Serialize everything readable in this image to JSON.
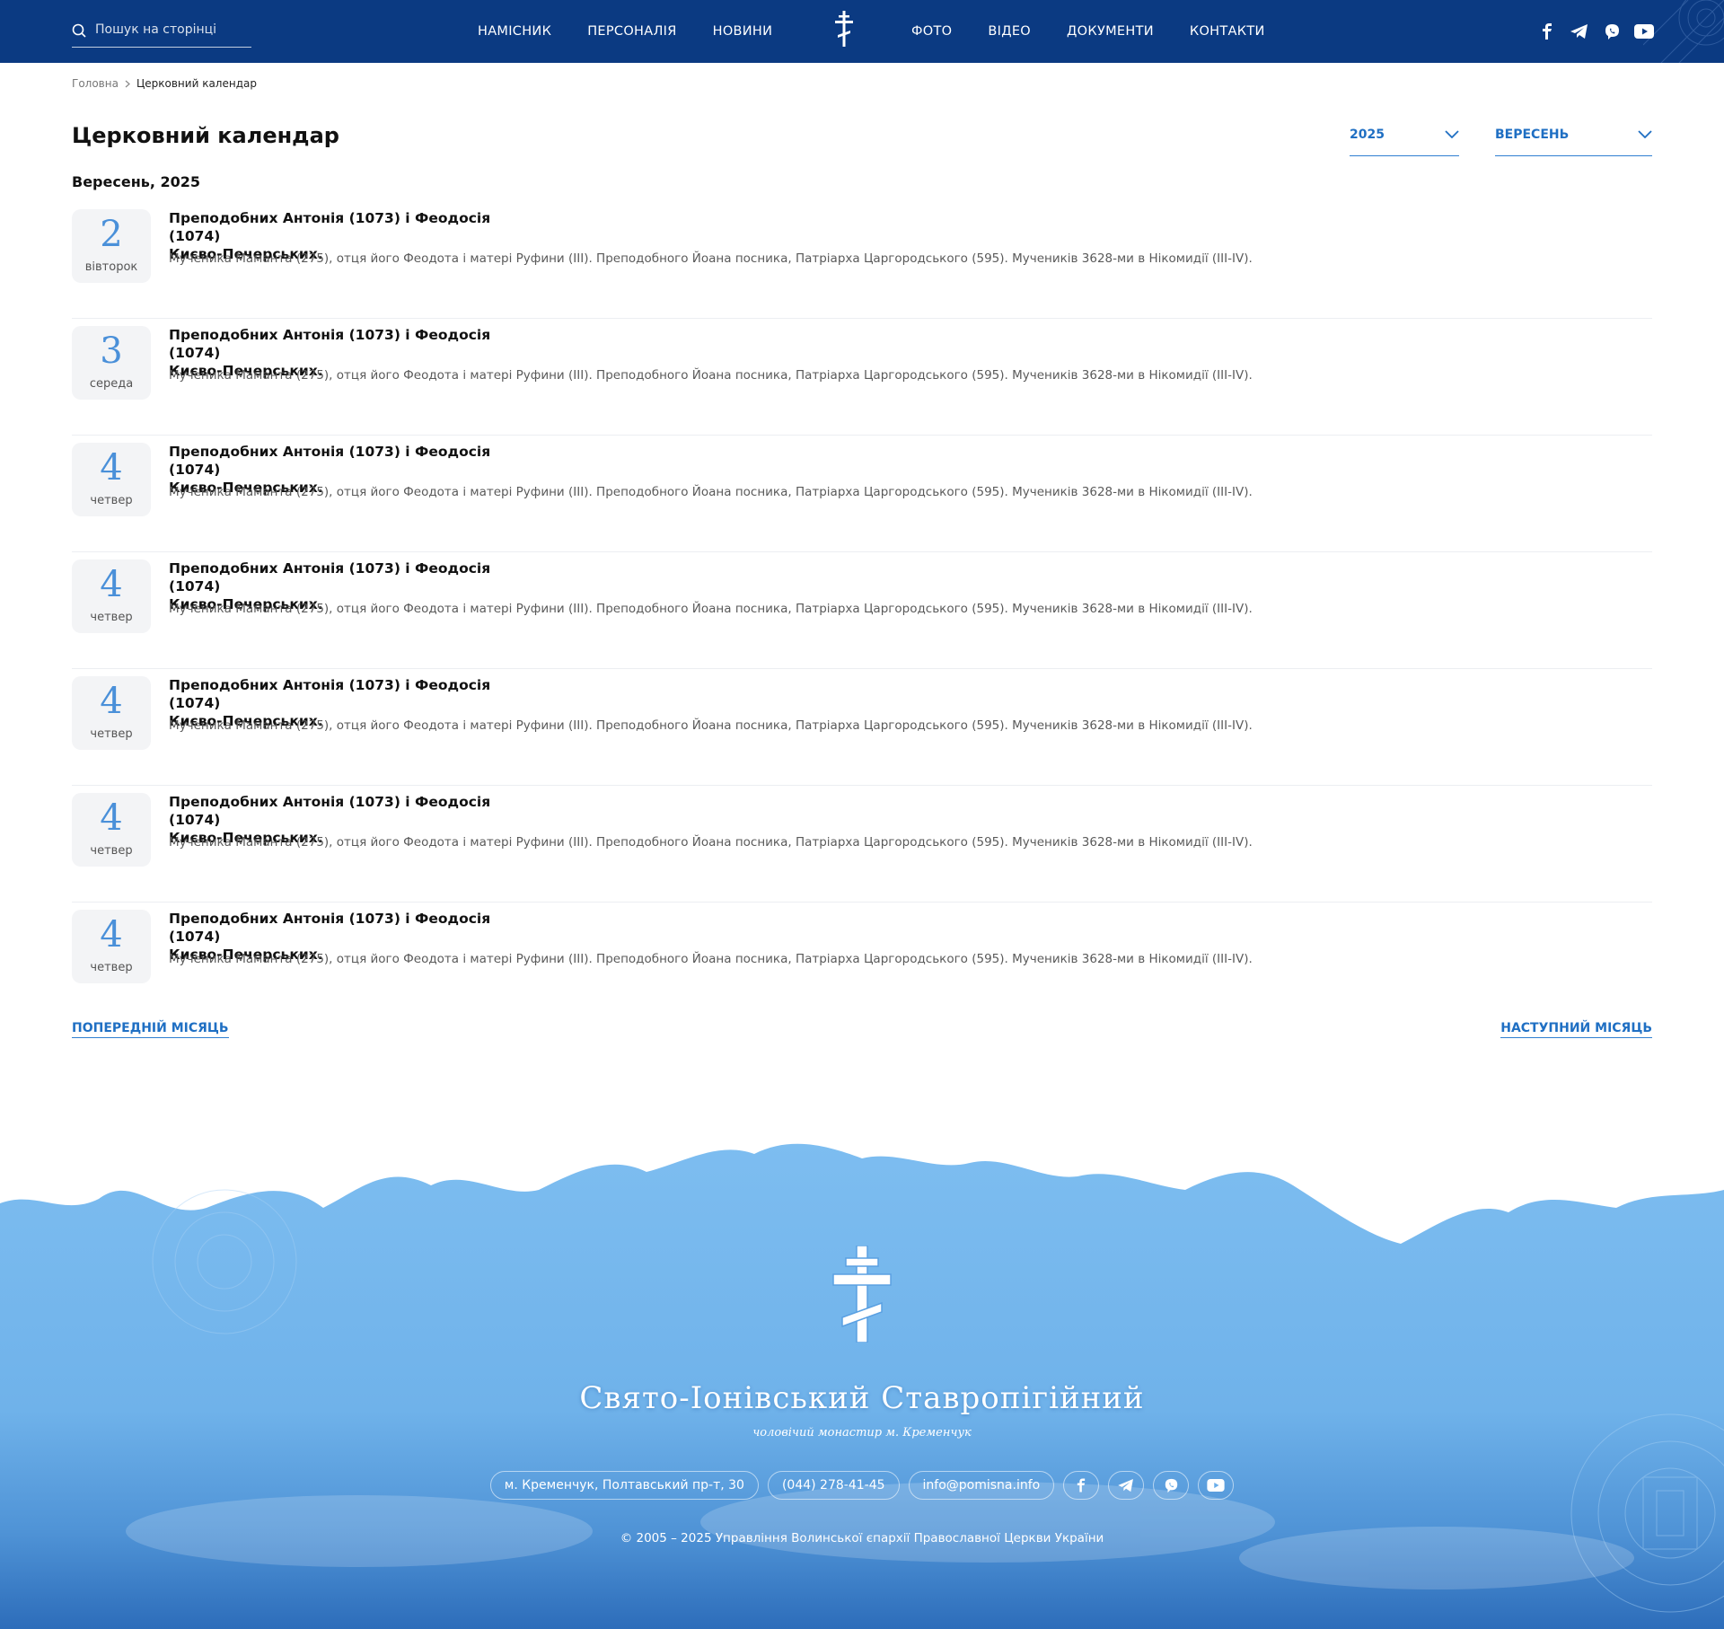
{
  "header": {
    "search_placeholder": "Пошук на сторінці",
    "nav_left": [
      "НАМІСНИК",
      "ПЕРСОНАЛІЯ",
      "НОВИНИ"
    ],
    "nav_right": [
      "ФОТО",
      "ВІДЕО",
      "ДОКУМЕНТИ",
      "КОНТАКТИ"
    ],
    "socials": [
      "facebook-icon",
      "telegram-icon",
      "viber-icon",
      "youtube-icon"
    ]
  },
  "breadcrumb": {
    "home": "Головна",
    "current": "Церковний календар"
  },
  "page": {
    "title": "Церковний календар",
    "year_select": "2025",
    "month_select": "ВЕРЕСЕНЬ",
    "month_heading": "Вересень, 2025"
  },
  "events": [
    {
      "day": "2",
      "weekday": "вівторок",
      "title_line1": "Преподобних Антонія (1073) і Феодосія (1074)",
      "title_line2": "Києво-Печерських.",
      "desc": "Мученика Маманта (275), отця його Феодота і матері Руфини (III). Преподобного Йоана посника, Патріарха Царгородського (595). Мучеників 3628-ми в Нікомидії (III-IV)."
    },
    {
      "day": "3",
      "weekday": "середа",
      "title_line1": "Преподобних Антонія (1073) і Феодосія (1074)",
      "title_line2": "Києво-Печерських.",
      "desc": "Мученика Маманта (275), отця його Феодота і матері Руфини (III). Преподобного Йоана посника, Патріарха Царгородського (595). Мучеників 3628-ми в Нікомидії (III-IV)."
    },
    {
      "day": "4",
      "weekday": "четвер",
      "title_line1": "Преподобних Антонія (1073) і Феодосія (1074)",
      "title_line2": "Києво-Печерських.",
      "desc": "Мученика Маманта (275), отця його Феодота і матері Руфини (III). Преподобного Йоана посника, Патріарха Царгородського (595). Мучеників 3628-ми в Нікомидії (III-IV)."
    },
    {
      "day": "4",
      "weekday": "четвер",
      "title_line1": "Преподобних Антонія (1073) і Феодосія (1074)",
      "title_line2": "Києво-Печерських.",
      "desc": "Мученика Маманта (275), отця його Феодота і матері Руфини (III). Преподобного Йоана посника, Патріарха Царгородського (595). Мучеників 3628-ми в Нікомидії (III-IV)."
    },
    {
      "day": "4",
      "weekday": "четвер",
      "title_line1": "Преподобних Антонія (1073) і Феодосія (1074)",
      "title_line2": "Києво-Печерських.",
      "desc": "Мученика Маманта (275), отця його Феодота і матері Руфини (III). Преподобного Йоана посника, Патріарха Царгородського (595). Мучеників 3628-ми в Нікомидії (III-IV)."
    },
    {
      "day": "4",
      "weekday": "четвер",
      "title_line1": "Преподобних Антонія (1073) і Феодосія (1074)",
      "title_line2": "Києво-Печерських.",
      "desc": "Мученика Маманта (275), отця його Феодота і матері Руфини (III). Преподобного Йоана посника, Патріарха Царгородського (595). Мучеників 3628-ми в Нікомидії (III-IV)."
    },
    {
      "day": "4",
      "weekday": "четвер",
      "title_line1": "Преподобних Антонія (1073) і Феодосія (1074)",
      "title_line2": "Києво-Печерських.",
      "desc": "Мученика Маманта (275), отця його Феодота і матері Руфини (III). Преподобного Йоана посника, Патріарха Царгородського (595). Мучеників 3628-ми в Нікомидії (III-IV)."
    }
  ],
  "pager": {
    "prev": "ПОПЕРЕДНІЙ МІСЯЦЬ",
    "next": "НАСТУПНИЙ МІСЯЦЬ"
  },
  "footer": {
    "name": "Свято-Іонівський Ставропігійний",
    "subtitle": "чоловічий монастир м. Кременчук",
    "address": "м. Кременчук, Полтавський пр-т, 30",
    "phone": "(044) 278-41-45",
    "email": "info@pomisna.info",
    "copyright": "© 2005 – 2025 Управління Волинської єпархії Православної Церкви України"
  },
  "colors": {
    "header_bg": "#0b3a82",
    "accent": "#1f6fc3",
    "day_number": "#4a90d9",
    "footer_sky": "#74b7ec"
  }
}
